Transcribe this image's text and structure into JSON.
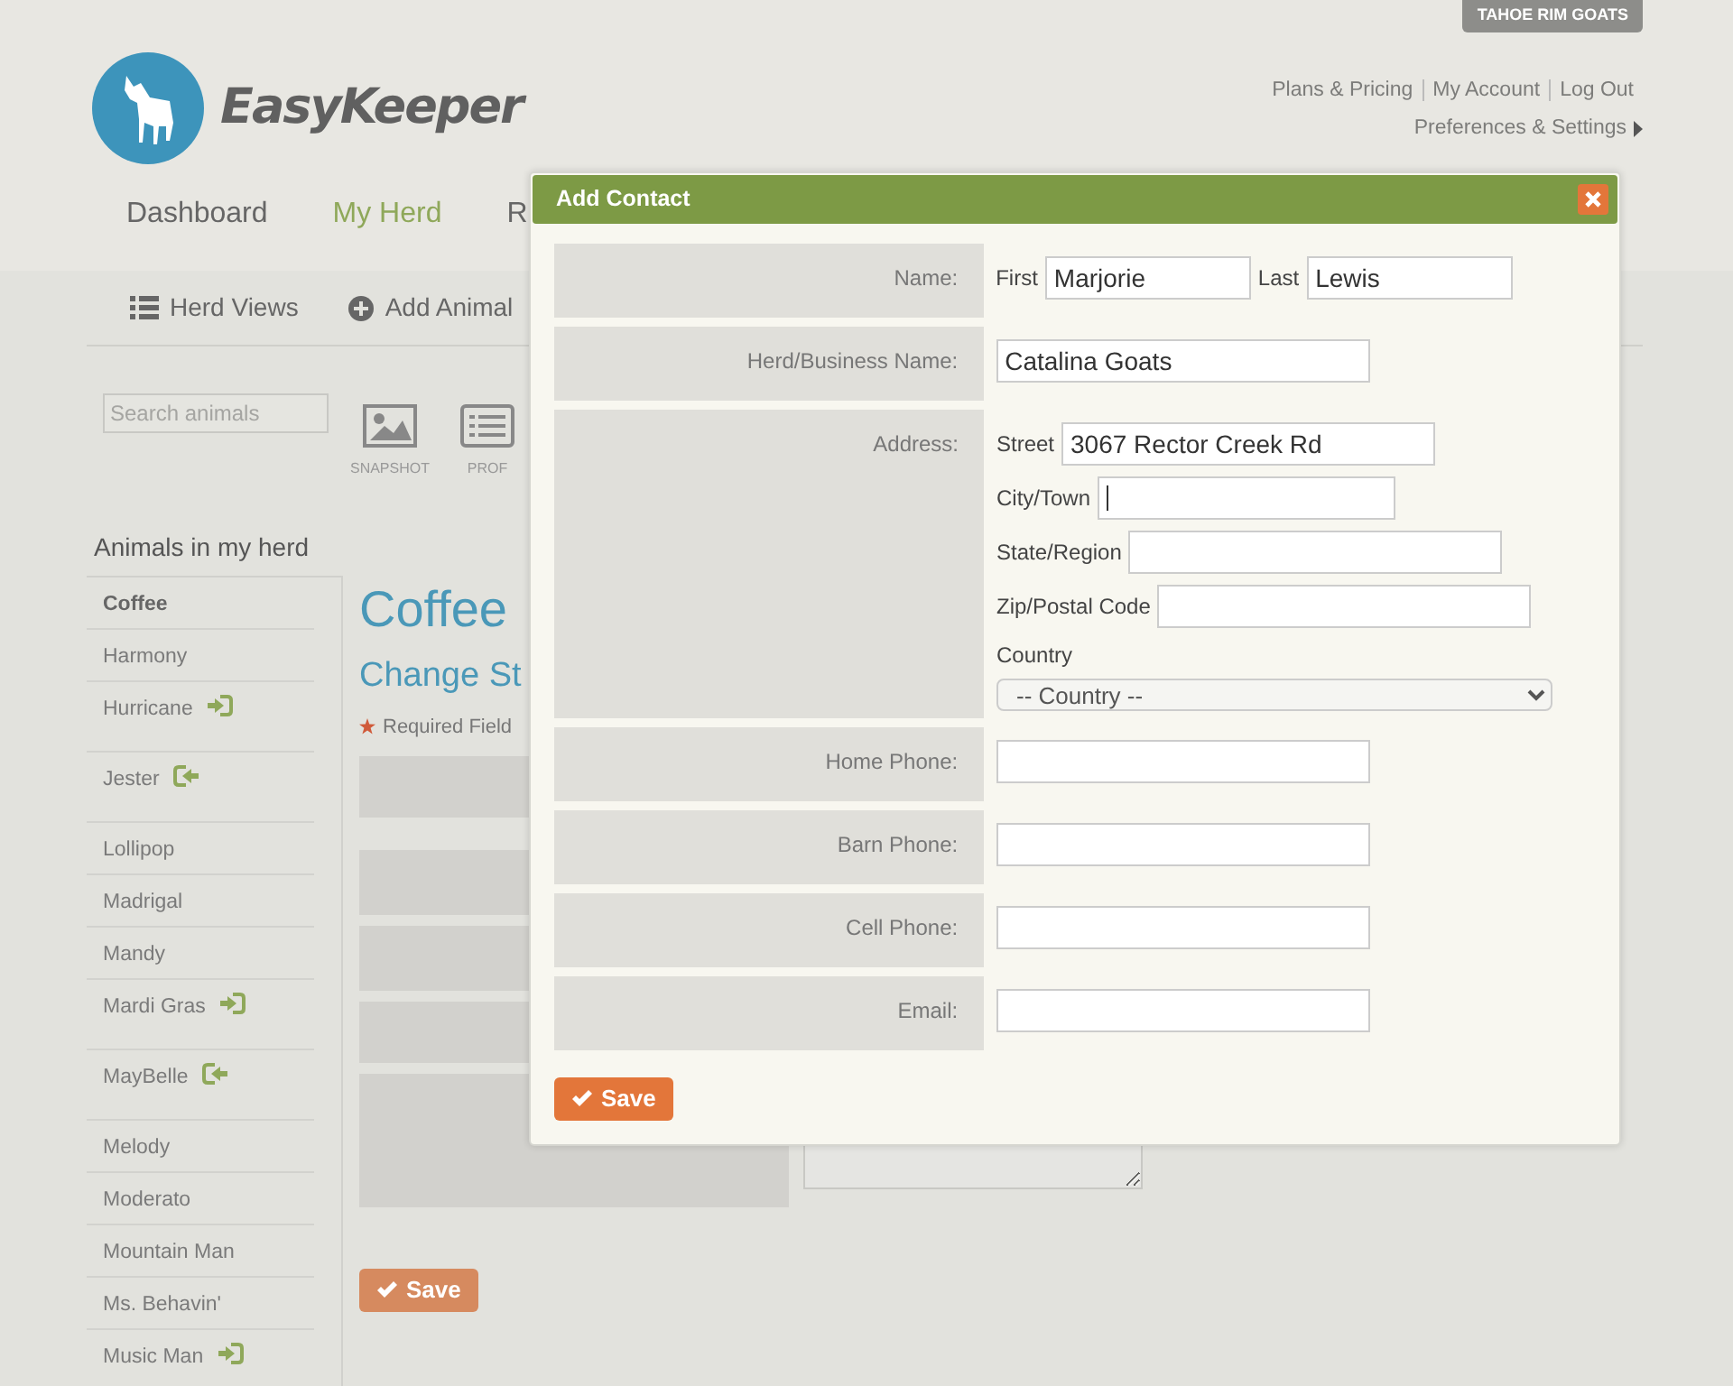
{
  "account_tag": "TAHOE RIM GOATS",
  "logo": {
    "wordmark": "EasyKeeper"
  },
  "top_links": [
    "Plans & Pricing",
    "My Account",
    "Log Out"
  ],
  "preferences_link": "Preferences & Settings",
  "nav": [
    {
      "label": "Dashboard",
      "selected": false
    },
    {
      "label": "My Herd",
      "selected": true
    },
    {
      "label": "R",
      "selected": false
    }
  ],
  "subnav": [
    {
      "label": "Herd Views",
      "kind": "list"
    },
    {
      "label": "Add Animal",
      "kind": "add"
    }
  ],
  "search": {
    "placeholder": "Search animals"
  },
  "view_icons": [
    {
      "label": "SNAPSHOT",
      "kind": "image"
    },
    {
      "label": "PROF",
      "kind": "list"
    }
  ],
  "sidebar": {
    "title": "Animals in my herd",
    "items": [
      {
        "label": "Coffee",
        "selected": true,
        "kind": "plain"
      },
      {
        "label": "Harmony",
        "selected": false,
        "kind": "plain"
      },
      {
        "label": "Hurricane",
        "selected": false,
        "kind": "arrow_right"
      },
      {
        "label": "Jester",
        "selected": false,
        "kind": "arrow_left"
      },
      {
        "label": "Lollipop",
        "selected": false,
        "kind": "plain"
      },
      {
        "label": "Madrigal",
        "selected": false,
        "kind": "plain"
      },
      {
        "label": "Mandy",
        "selected": false,
        "kind": "plain"
      },
      {
        "label": "Mardi Gras",
        "selected": false,
        "kind": "arrow_right"
      },
      {
        "label": "MayBelle",
        "selected": false,
        "kind": "arrow_left"
      },
      {
        "label": "Melody",
        "selected": false,
        "kind": "plain"
      },
      {
        "label": "Moderato",
        "selected": false,
        "kind": "plain"
      },
      {
        "label": "Mountain Man",
        "selected": false,
        "kind": "plain"
      },
      {
        "label": "Ms. Behavin'",
        "selected": false,
        "kind": "plain"
      },
      {
        "label": "Music Man",
        "selected": false,
        "kind": "arrow_right"
      }
    ]
  },
  "main": {
    "title": "Coffee",
    "subtitle": "Change St",
    "required_note": "Required Field",
    "save_button": "Save"
  },
  "dialog": {
    "title": "Add Contact",
    "save_button": "Save",
    "rows": [
      {
        "label": "Name:",
        "kind": "name",
        "fields": [
          {
            "kind": "text",
            "caption": "First",
            "value": "Marjorie",
            "focused": false
          },
          {
            "kind": "text",
            "caption": "Last",
            "value": "Lewis",
            "focused": false
          }
        ]
      },
      {
        "label": "Herd/Business Name:",
        "kind": "single",
        "fields": [
          {
            "kind": "text",
            "value": "Catalina Goats",
            "focused": false
          }
        ]
      },
      {
        "label": "Address:",
        "kind": "address",
        "fields": [
          {
            "kind": "text",
            "caption": "Street",
            "value": "3067 Rector Creek Rd",
            "focused": false
          },
          {
            "kind": "text",
            "caption": "City/Town",
            "focused": true
          },
          {
            "kind": "text",
            "caption": "State/Region",
            "focused": false
          },
          {
            "kind": "text",
            "caption": "Zip/Postal Code",
            "focused": false
          },
          {
            "kind": "select",
            "caption": "Country",
            "value": "-- Country --"
          }
        ]
      },
      {
        "label": "Home Phone:",
        "kind": "single",
        "fields": [
          {
            "kind": "text",
            "focused": false
          }
        ]
      },
      {
        "label": "Barn Phone:",
        "kind": "single",
        "fields": [
          {
            "kind": "text",
            "focused": false
          }
        ]
      },
      {
        "label": "Cell Phone:",
        "kind": "single",
        "fields": [
          {
            "kind": "text",
            "focused": false
          }
        ]
      },
      {
        "label": "Email:",
        "kind": "single",
        "fields": [
          {
            "kind": "text",
            "focused": false
          }
        ]
      }
    ]
  }
}
